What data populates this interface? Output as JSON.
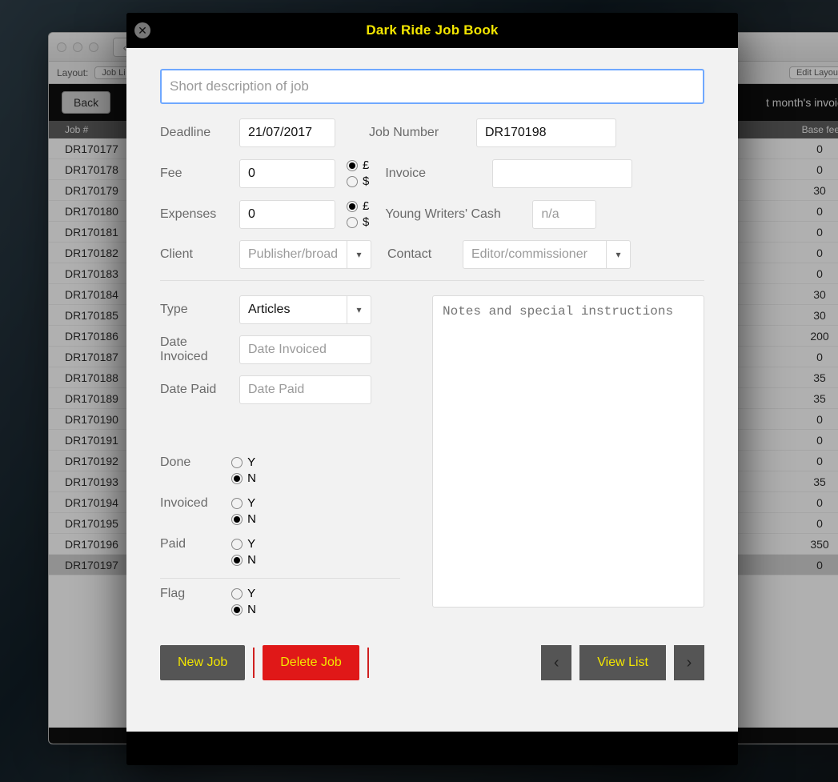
{
  "app": {
    "title": "Dark Ride Job Book"
  },
  "background_window": {
    "layout_label": "Layout:",
    "layout_value": "Job Li",
    "edit_layout": "Edit Layout",
    "back_button": "Back",
    "right_text": "t month's invoic",
    "col_job": "Job #",
    "col_fee": "Base fee",
    "rows": [
      {
        "job": "DR170177",
        "fee": "0"
      },
      {
        "job": "DR170178",
        "fee": "0"
      },
      {
        "job": "DR170179",
        "fee": "30"
      },
      {
        "job": "DR170180",
        "fee": "0"
      },
      {
        "job": "DR170181",
        "fee": "0"
      },
      {
        "job": "DR170182",
        "fee": "0"
      },
      {
        "job": "DR170183",
        "fee": "0"
      },
      {
        "job": "DR170184",
        "fee": "30"
      },
      {
        "job": "DR170185",
        "fee": "30"
      },
      {
        "job": "DR170186",
        "fee": "200"
      },
      {
        "job": "DR170187",
        "fee": "0"
      },
      {
        "job": "DR170188",
        "fee": "35"
      },
      {
        "job": "DR170189",
        "fee": "35"
      },
      {
        "job": "DR170190",
        "fee": "0"
      },
      {
        "job": "DR170191",
        "fee": "0"
      },
      {
        "job": "DR170192",
        "fee": "0"
      },
      {
        "job": "DR170193",
        "fee": "35"
      },
      {
        "job": "DR170194",
        "fee": "0"
      },
      {
        "job": "DR170195",
        "fee": "0"
      },
      {
        "job": "DR170196",
        "fee": "350"
      },
      {
        "job": "DR170197",
        "fee": "0",
        "selected": true
      }
    ]
  },
  "form": {
    "desc_placeholder": "Short description of job",
    "labels": {
      "deadline": "Deadline",
      "fee": "Fee",
      "expenses": "Expenses",
      "client": "Client",
      "job_number": "Job Number",
      "invoice": "Invoice",
      "ywc": "Young Writers' Cash",
      "contact": "Contact",
      "type": "Type",
      "date_invoiced": "Date Invoiced",
      "date_paid": "Date Paid",
      "done": "Done",
      "invoiced": "Invoiced",
      "paid": "Paid",
      "flag": "Flag"
    },
    "values": {
      "deadline": "21/07/2017",
      "fee": "0",
      "expenses": "0",
      "job_number": "DR170198",
      "invoice": "",
      "ywc_placeholder": "n/a",
      "client_placeholder": "Publisher/broad",
      "contact_placeholder": "Editor/commissioner",
      "type": "Articles",
      "date_invoiced_placeholder": "Date Invoiced",
      "date_paid_placeholder": "Date Paid",
      "notes_placeholder": "Notes and special instructions"
    },
    "currency": {
      "pound": "£",
      "dollar": "$",
      "fee_selected": "pound",
      "expenses_selected": "pound"
    },
    "yn": {
      "y": "Y",
      "n": "N",
      "done": "N",
      "invoiced": "N",
      "paid": "N",
      "flag": "N"
    },
    "buttons": {
      "new_job": "New Job",
      "delete_job": "Delete Job",
      "view_list": "View List"
    }
  }
}
